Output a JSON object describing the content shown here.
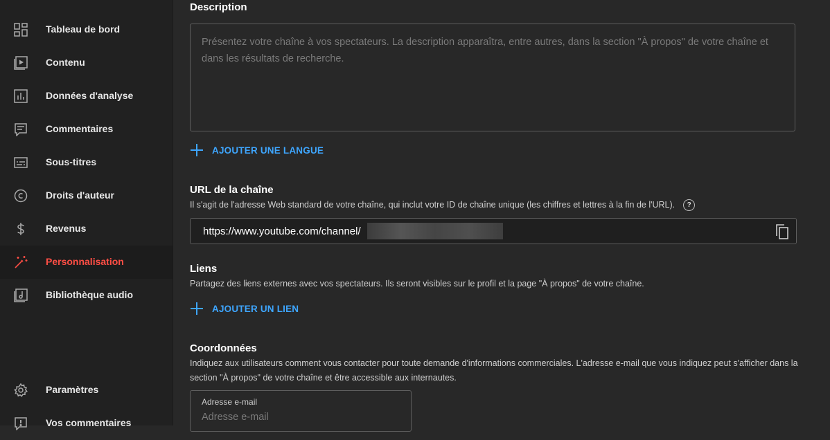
{
  "sidebar": {
    "items": [
      {
        "label": "Tableau de bord",
        "icon": "dashboard-icon"
      },
      {
        "label": "Contenu",
        "icon": "content-icon"
      },
      {
        "label": "Données d'analyse",
        "icon": "analytics-icon"
      },
      {
        "label": "Commentaires",
        "icon": "comments-icon"
      },
      {
        "label": "Sous-titres",
        "icon": "subtitles-icon"
      },
      {
        "label": "Droits d'auteur",
        "icon": "copyright-icon"
      },
      {
        "label": "Revenus",
        "icon": "dollar-icon"
      },
      {
        "label": "Personnalisation",
        "icon": "magic-wand-icon",
        "active": true
      },
      {
        "label": "Bibliothèque audio",
        "icon": "audio-library-icon"
      }
    ],
    "bottom": [
      {
        "label": "Paramètres",
        "icon": "gear-icon"
      },
      {
        "label": "Vos commentaires",
        "icon": "feedback-icon"
      }
    ]
  },
  "description": {
    "title": "Description",
    "placeholder": "Présentez votre chaîne à vos spectateurs. La description apparaîtra, entre autres, dans la section \"À propos\" de votre chaîne et dans les résultats de recherche.",
    "add_language": "AJOUTER UNE LANGUE"
  },
  "channel_url": {
    "title": "URL de la chaîne",
    "subtitle": "Il s'agit de l'adresse Web standard de votre chaîne, qui inclut votre ID de chaîne unique (les chiffres et lettres à la fin de l'URL).",
    "help": "?",
    "value": "https://www.youtube.com/channel/"
  },
  "links": {
    "title": "Liens",
    "subtitle": "Partagez des liens externes avec vos spectateurs. Ils seront visibles sur le profil et la page \"À propos\" de votre chaîne.",
    "add_link": "AJOUTER UN LIEN"
  },
  "contact": {
    "title": "Coordonnées",
    "subtitle": "Indiquez aux utilisateurs comment vous contacter pour toute demande d'informations commerciales. L'adresse e-mail que vous indiquez peut s'afficher dans la section \"À propos\" de votre chaîne et être accessible aux internautes.",
    "email_label": "Adresse e-mail",
    "email_placeholder": "Adresse e-mail"
  },
  "colors": {
    "accent": "#3ea6ff",
    "active": "#ff4e45",
    "background": "#282828",
    "sidebar": "#212121"
  }
}
